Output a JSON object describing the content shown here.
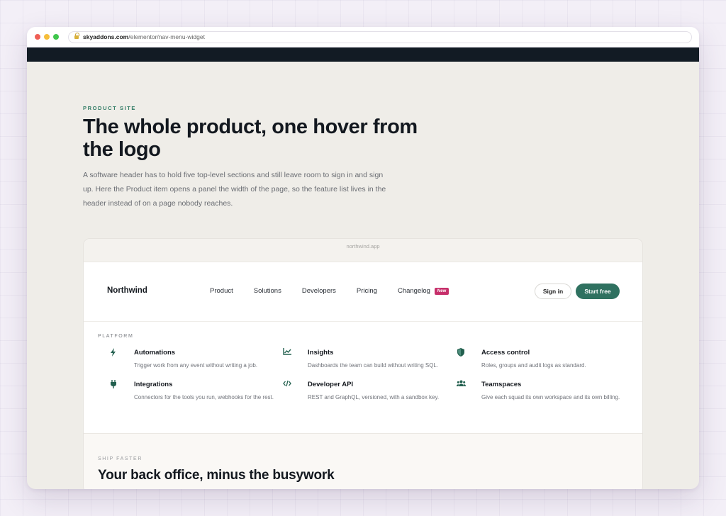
{
  "browser": {
    "url_domain": "skyaddons.com",
    "url_path": "/elementor/nav-menu-widget"
  },
  "hero": {
    "eyebrow": "PRODUCT SITE",
    "headline": "The whole product, one hover from the logo",
    "lede": "A software header has to hold five top-level sections and still leave room to sign in and sign up. Here the Product item opens a panel the width of the page, so the feature list lives in the header instead of on a page nobody reaches."
  },
  "demo": {
    "domain": "northwind.app",
    "logo": "Northwind",
    "menu": [
      {
        "label": "Product"
      },
      {
        "label": "Solutions"
      },
      {
        "label": "Developers"
      },
      {
        "label": "Pricing"
      },
      {
        "label": "Changelog",
        "badge": "New"
      }
    ],
    "signin": "Sign in",
    "start_free": "Start free",
    "panel": {
      "eyebrow": "PLATFORM",
      "features": [
        {
          "icon": "bolt-icon",
          "glyph": "⚡",
          "title": "Automations",
          "desc": "Trigger work from any event without writing a job."
        },
        {
          "icon": "chart-icon",
          "glyph": "📈",
          "title": "Insights",
          "desc": "Dashboards the team can build without writing SQL."
        },
        {
          "icon": "shield-icon",
          "glyph": "◆",
          "title": "Access control",
          "desc": "Roles, groups and audit logs as standard."
        },
        {
          "icon": "plug-icon",
          "glyph": "⏚",
          "title": "Integrations",
          "desc": "Connectors for the tools you run, webhooks for the rest."
        },
        {
          "icon": "code-icon",
          "glyph": "</>",
          "title": "Developer API",
          "desc": "REST and GraphQL, versioned, with a sandbox key."
        },
        {
          "icon": "users-icon",
          "glyph": "👥",
          "title": "Teamspaces",
          "desc": "Give each squad its own workspace and its own billing."
        }
      ]
    },
    "ship": {
      "eyebrow": "SHIP FASTER",
      "title": "Your back office, minus the busywork"
    }
  }
}
